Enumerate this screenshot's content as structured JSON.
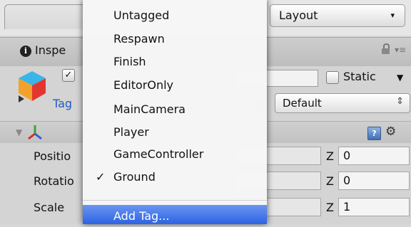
{
  "toolbar": {
    "layout_label": "Layout",
    "caret": "▾"
  },
  "inspector": {
    "tab_label": "Inspe",
    "info_glyph": "i",
    "menu_glyph": "▾≡",
    "active_check": "✓",
    "static_label": "Static",
    "static_caret": "▼",
    "tag_label": "Tag",
    "layer_label_fragment": "r",
    "layer_value": "Default",
    "layer_caret": "⇕"
  },
  "transform": {
    "foldout_glyph": "▼",
    "help_glyph": "?",
    "cog_glyph": "⚙",
    "rows": [
      {
        "label": "Positio",
        "z_label": "Z",
        "z_value": "0"
      },
      {
        "label": "Rotatio",
        "z_label": "Z",
        "z_value": "0"
      },
      {
        "label": "Scale",
        "z_label": "Z",
        "z_value": "1"
      }
    ]
  },
  "tag_menu": {
    "items": [
      {
        "label": "Untagged",
        "checked": false
      },
      {
        "label": "Respawn",
        "checked": false
      },
      {
        "label": "Finish",
        "checked": false
      },
      {
        "label": "EditorOnly",
        "checked": false
      },
      {
        "label": "MainCamera",
        "checked": false
      },
      {
        "label": "Player",
        "checked": false
      },
      {
        "label": "GameController",
        "checked": false
      },
      {
        "label": "Ground",
        "checked": true
      }
    ],
    "check_glyph": "✓",
    "add_tag_label": "Add Tag..."
  },
  "colors": {
    "highlight": "#2c63e3",
    "tag_label": "#1f5dc4"
  }
}
